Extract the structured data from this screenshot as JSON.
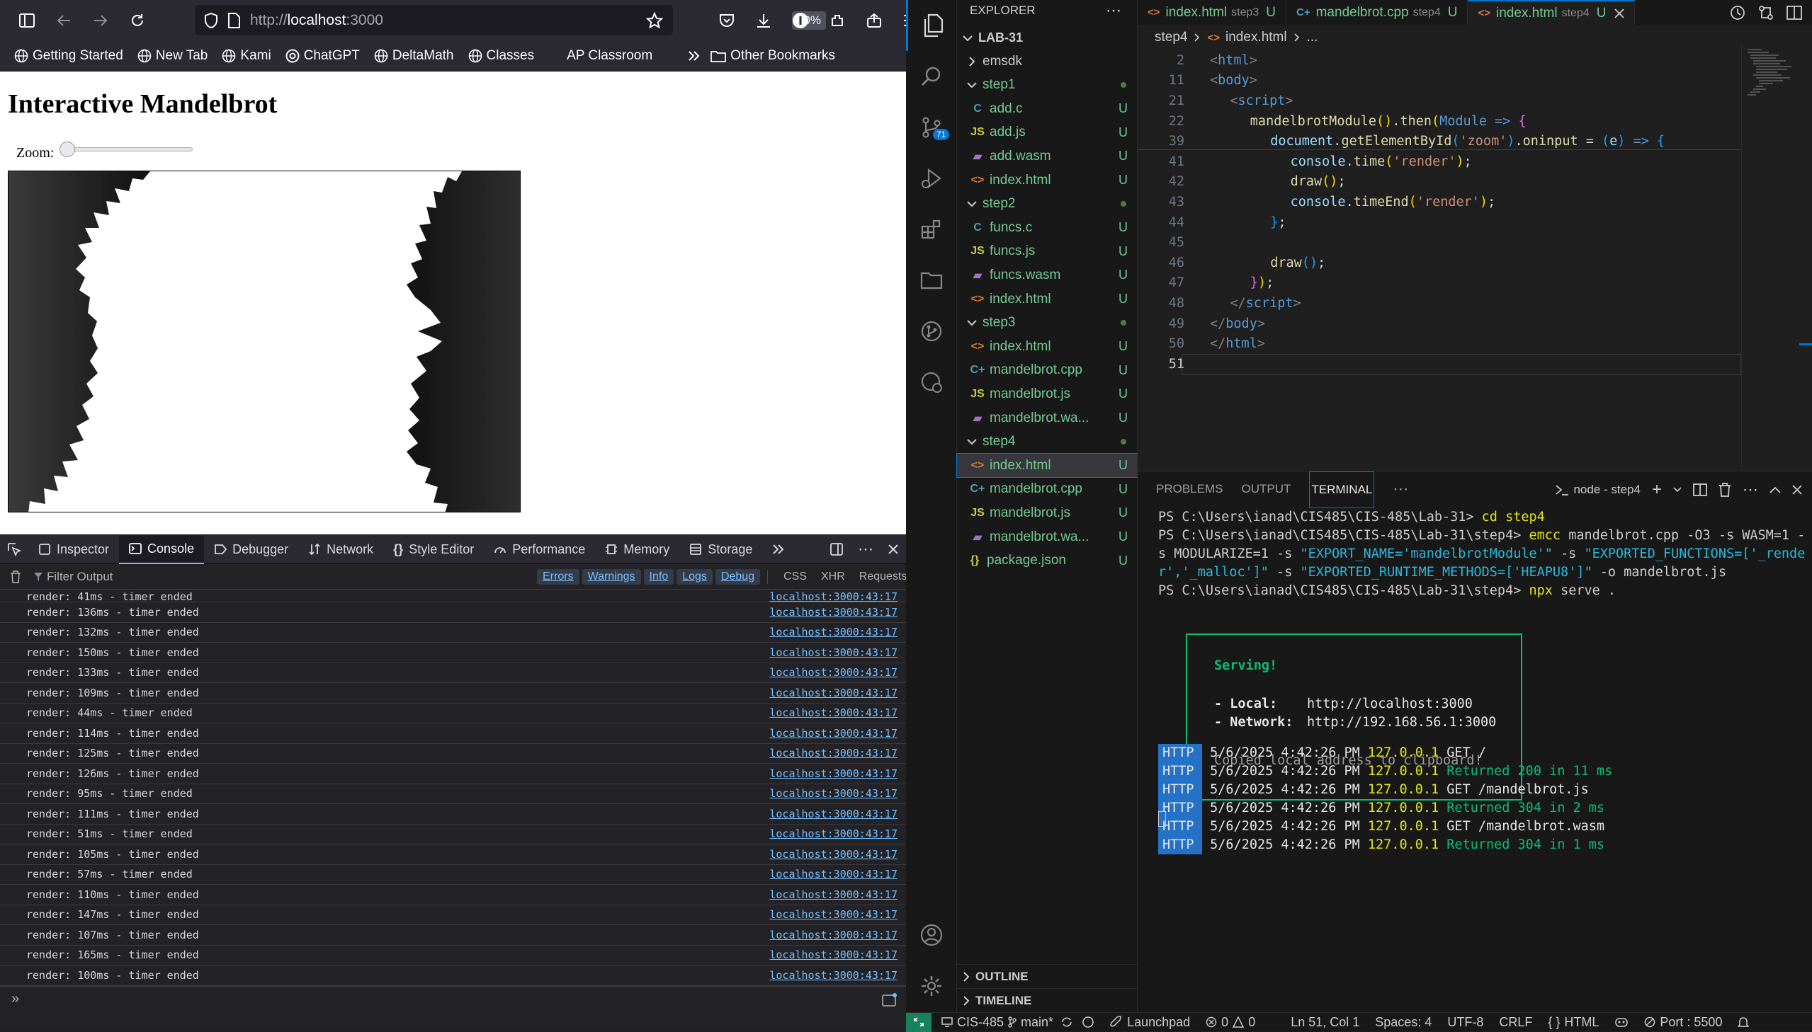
{
  "browser": {
    "url_dim": "http://",
    "url_host": "localhost",
    "url_port": ":3000",
    "zoom": "80%",
    "bookmarks": [
      "Getting Started",
      "New Tab",
      "Kami",
      "ChatGPT",
      "DeltaMath",
      "Classes",
      "AP Classroom"
    ],
    "other_bookmarks": "Other Bookmarks",
    "page": {
      "title": "Interactive Mandelbrot",
      "zoom_label": "Zoom:",
      "zoom_slider_value": 0
    },
    "devtools": {
      "tabs": [
        "Inspector",
        "Console",
        "Debugger",
        "Network",
        "Style Editor",
        "Performance",
        "Memory",
        "Storage"
      ],
      "active_tab": "Console",
      "filter_placeholder": "Filter Output",
      "filters": [
        "Errors",
        "Warnings",
        "Info",
        "Logs",
        "Debug"
      ],
      "extra_filters": [
        "CSS",
        "XHR",
        "Requests"
      ],
      "logs": [
        {
          "msg": "render: 41ms - timer ended",
          "src": "localhost:3000:43:17"
        },
        {
          "msg": "render: 136ms - timer ended",
          "src": "localhost:3000:43:17"
        },
        {
          "msg": "render: 132ms - timer ended",
          "src": "localhost:3000:43:17"
        },
        {
          "msg": "render: 150ms - timer ended",
          "src": "localhost:3000:43:17"
        },
        {
          "msg": "render: 133ms - timer ended",
          "src": "localhost:3000:43:17"
        },
        {
          "msg": "render: 109ms - timer ended",
          "src": "localhost:3000:43:17"
        },
        {
          "msg": "render: 44ms - timer ended",
          "src": "localhost:3000:43:17"
        },
        {
          "msg": "render: 114ms - timer ended",
          "src": "localhost:3000:43:17"
        },
        {
          "msg": "render: 125ms - timer ended",
          "src": "localhost:3000:43:17"
        },
        {
          "msg": "render: 126ms - timer ended",
          "src": "localhost:3000:43:17"
        },
        {
          "msg": "render: 95ms - timer ended",
          "src": "localhost:3000:43:17"
        },
        {
          "msg": "render: 111ms - timer ended",
          "src": "localhost:3000:43:17"
        },
        {
          "msg": "render: 51ms - timer ended",
          "src": "localhost:3000:43:17"
        },
        {
          "msg": "render: 105ms - timer ended",
          "src": "localhost:3000:43:17"
        },
        {
          "msg": "render: 57ms - timer ended",
          "src": "localhost:3000:43:17"
        },
        {
          "msg": "render: 110ms - timer ended",
          "src": "localhost:3000:43:17"
        },
        {
          "msg": "render: 147ms - timer ended",
          "src": "localhost:3000:43:17"
        },
        {
          "msg": "render: 107ms - timer ended",
          "src": "localhost:3000:43:17"
        },
        {
          "msg": "render: 165ms - timer ended",
          "src": "localhost:3000:43:17"
        },
        {
          "msg": "render: 100ms - timer ended",
          "src": "localhost:3000:43:17"
        }
      ],
      "prompt": "»"
    }
  },
  "vscode": {
    "explorer_title": "EXPLORER",
    "root": "LAB-31",
    "tree": [
      {
        "label": "emsdk",
        "type": "folder-closed",
        "indent": 1,
        "badge": ""
      },
      {
        "label": "step1",
        "type": "folder-open",
        "indent": 1,
        "badge": "dot"
      },
      {
        "label": "add.c",
        "type": "c",
        "indent": 2,
        "badge": "U"
      },
      {
        "label": "add.js",
        "type": "js",
        "indent": 2,
        "badge": "U"
      },
      {
        "label": "add.wasm",
        "type": "wasm",
        "indent": 2,
        "badge": "U"
      },
      {
        "label": "index.html",
        "type": "html",
        "indent": 2,
        "badge": "U"
      },
      {
        "label": "step2",
        "type": "folder-open",
        "indent": 1,
        "badge": "dot"
      },
      {
        "label": "funcs.c",
        "type": "c",
        "indent": 2,
        "badge": "U"
      },
      {
        "label": "funcs.js",
        "type": "js",
        "indent": 2,
        "badge": "U"
      },
      {
        "label": "funcs.wasm",
        "type": "wasm",
        "indent": 2,
        "badge": "U"
      },
      {
        "label": "index.html",
        "type": "html",
        "indent": 2,
        "badge": "U"
      },
      {
        "label": "step3",
        "type": "folder-open",
        "indent": 1,
        "badge": "dot"
      },
      {
        "label": "index.html",
        "type": "html",
        "indent": 2,
        "badge": "U"
      },
      {
        "label": "mandelbrot.cpp",
        "type": "cpp",
        "indent": 2,
        "badge": "U"
      },
      {
        "label": "mandelbrot.js",
        "type": "js",
        "indent": 2,
        "badge": "U"
      },
      {
        "label": "mandelbrot.wa...",
        "type": "wasm",
        "indent": 2,
        "badge": "U"
      },
      {
        "label": "step4",
        "type": "folder-open",
        "indent": 1,
        "badge": "dot"
      },
      {
        "label": "index.html",
        "type": "html",
        "indent": 2,
        "badge": "U",
        "selected": true
      },
      {
        "label": "mandelbrot.cpp",
        "type": "cpp",
        "indent": 2,
        "badge": "U"
      },
      {
        "label": "mandelbrot.js",
        "type": "js",
        "indent": 2,
        "badge": "U"
      },
      {
        "label": "mandelbrot.wa...",
        "type": "wasm",
        "indent": 2,
        "badge": "U"
      },
      {
        "label": "package.json",
        "type": "json",
        "indent": 1,
        "badge": "U"
      }
    ],
    "outline": "OUTLINE",
    "timeline": "TIMELINE",
    "scm_badge": "71",
    "tabs": [
      {
        "name": "index.html",
        "sub": "step3",
        "badge": "U",
        "icon": "html"
      },
      {
        "name": "mandelbrot.cpp",
        "sub": "step4",
        "badge": "U",
        "icon": "cpp"
      },
      {
        "name": "index.html",
        "sub": "step4",
        "badge": "U",
        "icon": "html",
        "active": true
      }
    ],
    "breadcrumb": [
      "step4",
      "index.html",
      "..."
    ],
    "code_lines": [
      {
        "n": "2",
        "html": "<span class='tg'>&lt;</span><span class='tn'>html</span><span class='tg'>&gt;</span>",
        "indent": 0
      },
      {
        "n": "11",
        "html": "<span class='tg'>&lt;</span><span class='tn'>body</span><span class='tg'>&gt;</span>",
        "indent": 0
      },
      {
        "n": "21",
        "html": "<span class='tg'>&lt;</span><span class='tn'>script</span><span class='tg'>&gt;</span>",
        "indent": 1
      },
      {
        "n": "22",
        "html": "<span class='fn'>mandelbrotModule</span><span class='br'>()</span>.<span class='fn'>then</span><span class='br'>(</span><span class='tn'>Module</span> <span class='tn'>=&gt;</span> <span class='br2'>{</span>",
        "indent": 2
      },
      {
        "n": "39",
        "html": "<span class='vr'>document</span>.<span class='fn'>getElementById</span><span class='br3'>(</span><span class='st'>'zoom'</span><span class='br3'>)</span>.<span class='fn'>oninput</span> = <span class='br3'>(</span><span class='vr'>e</span><span class='br3'>)</span> <span class='tn'>=&gt;</span> <span class='br3'>{</span>",
        "indent": 3
      },
      {
        "n": "41",
        "html": "<span class='vr'>console</span>.<span class='fn'>time</span><span class='br'>(</span><span class='st'>'render'</span><span class='br'>)</span>;",
        "indent": 4
      },
      {
        "n": "42",
        "html": "<span class='fn'>draw</span><span class='br'>()</span>;",
        "indent": 4
      },
      {
        "n": "43",
        "html": "<span class='vr'>console</span>.<span class='fn'>timeEnd</span><span class='br'>(</span><span class='st'>'render'</span><span class='br'>)</span>;",
        "indent": 4
      },
      {
        "n": "44",
        "html": "<span class='br3'>}</span>;",
        "indent": 3
      },
      {
        "n": "45",
        "html": "",
        "indent": 0
      },
      {
        "n": "46",
        "html": "<span class='fn'>draw</span><span class='br3'>()</span>;",
        "indent": 3
      },
      {
        "n": "47",
        "html": "<span class='br2'>}</span><span class='br'>)</span>;",
        "indent": 2
      },
      {
        "n": "48",
        "html": "<span class='tg'>&lt;/</span><span class='tn'>script</span><span class='tg'>&gt;</span>",
        "indent": 1
      },
      {
        "n": "49",
        "html": "<span class='tg'>&lt;/</span><span class='tn'>body</span><span class='tg'>&gt;</span>",
        "indent": 0
      },
      {
        "n": "50",
        "html": "<span class='tg'>&lt;/</span><span class='tn'>html</span><span class='tg'>&gt;</span>",
        "indent": 0
      },
      {
        "n": "51",
        "html": "",
        "indent": 0
      }
    ],
    "panel_tabs": [
      "PROBLEMS",
      "OUTPUT",
      "TERMINAL"
    ],
    "terminal_name": "node - step4",
    "terminal": {
      "line1_prompt": "PS C:\\Users\\ianad\\CIS485\\CIS-485\\Lab-31>",
      "line1_cmd": "cd step4",
      "line2_prompt": "PS C:\\Users\\ianad\\CIS485\\CIS-485\\Lab-31\\step4>",
      "emcc_l1": "mandelbrot.cpp -O3 -s WASM=1 -",
      "emcc_l2a": "s MODULARIZE=1 -s ",
      "emcc_l2b": "\"EXPORT_NAME='mandelbrotModule'\"",
      "emcc_l2c": " -s ",
      "emcc_l2d": "\"EXPORTED_FUNCTIONS=['_rende",
      "emcc_l3a": "r','_malloc']\"",
      "emcc_l3b": " -s ",
      "emcc_l3c": "\"EXPORTED_RUNTIME_METHODS=['HEAPU8']\"",
      "emcc_l3d": " -o mandelbrot.js",
      "emcc": "emcc",
      "line4_prompt": "PS C:\\Users\\ianad\\CIS485\\CIS-485\\Lab-31\\step4>",
      "npx": "npx",
      "npx_rest": "serve .",
      "serving": "Serving!",
      "local_label": "- Local:",
      "local_url": "http://localhost:3000",
      "network_label": "- Network:",
      "network_url": "http://192.168.56.1:3000",
      "copied": "Copied local address to clipboard!",
      "http_logs": [
        {
          "tag": "HTTP",
          "date": "5/6/2025 4:42:26 PM",
          "ip": "127.0.0.1",
          "msg": "GET /",
          "kind": "get"
        },
        {
          "tag": "HTTP",
          "date": "5/6/2025 4:42:26 PM",
          "ip": "127.0.0.1",
          "msg": "Returned 200 in 11 ms",
          "kind": "ret"
        },
        {
          "tag": "HTTP",
          "date": "5/6/2025 4:42:26 PM",
          "ip": "127.0.0.1",
          "msg": "GET /mandelbrot.js",
          "kind": "get"
        },
        {
          "tag": "HTTP",
          "date": "5/6/2025 4:42:26 PM",
          "ip": "127.0.0.1",
          "msg": "Returned 304 in 2 ms",
          "kind": "ret"
        },
        {
          "tag": "HTTP",
          "date": "5/6/2025 4:42:26 PM",
          "ip": "127.0.0.1",
          "msg": "GET /mandelbrot.wasm",
          "kind": "get"
        },
        {
          "tag": "HTTP",
          "date": "5/6/2025 4:42:26 PM",
          "ip": "127.0.0.1",
          "msg": "Returned 304 in 1 ms",
          "kind": "ret"
        }
      ]
    },
    "status": {
      "repo": "CIS-485",
      "branch": "main*",
      "errors": "0",
      "warnings": "0",
      "launchpad": "Launchpad",
      "position": "Ln 51, Col 1",
      "spaces": "Spaces: 4",
      "encoding": "UTF-8",
      "eol": "CRLF",
      "language": "HTML",
      "port": "Port : 5500"
    }
  }
}
